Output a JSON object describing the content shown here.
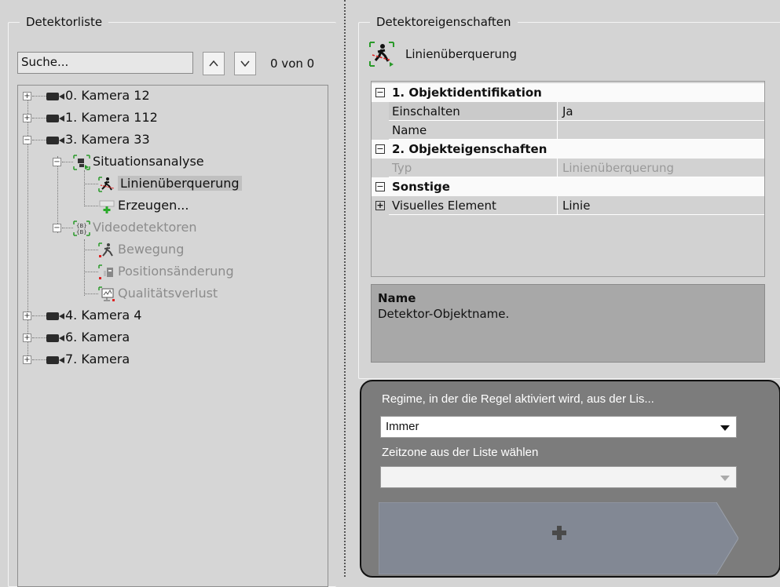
{
  "left": {
    "title": "Detektorliste",
    "search_value": "Suche...",
    "up_label": "^",
    "down_label": "v",
    "count": "0 von 0",
    "tree": {
      "cam0": "0. Kamera 12",
      "cam1": "1. Kamera 112",
      "cam3": "3. Kamera 33",
      "situation": "Situationsanalyse",
      "line_crossing": "Linienüberquerung",
      "create": "Erzeugen...",
      "video": "Videodetektoren",
      "motion": "Bewegung",
      "position": "Positionsänderung",
      "quality": "Qualitätsverlust",
      "cam4": "4. Kamera 4",
      "cam6": "6. Kamera",
      "cam7": "7. Kamera"
    }
  },
  "right": {
    "title": "Detektoreigenschaften",
    "detector_name": "Linienüberquerung",
    "grid": {
      "cat1": "1. Objektidentifikation",
      "enable_label": "Einschalten",
      "enable_value": "Ja",
      "name_label": "Name",
      "name_value": "",
      "cat2": "2. Objekteigenschaften",
      "type_label": "Typ",
      "type_value": "Linienüberquerung",
      "cat3": "Sonstige",
      "visual_label": "Visuelles Element",
      "visual_value": "Linie"
    },
    "description": {
      "title": "Name",
      "text": "Detektor-Objektname."
    }
  },
  "rules": {
    "mode_label": "Regime, in der die Regel aktiviert wird, aus der Lis...",
    "mode_value": "Immer",
    "timezone_label": "Zeitzone aus der Liste wählen",
    "timezone_value": "",
    "add_icon": "plus-icon"
  }
}
